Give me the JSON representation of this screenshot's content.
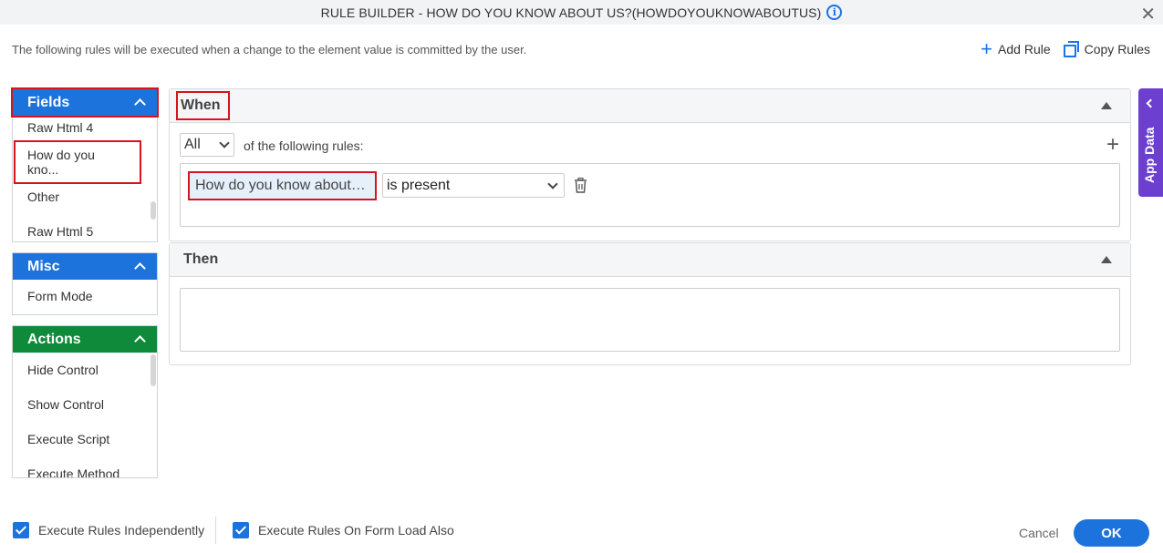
{
  "dialog": {
    "title": "RULE BUILDER - HOW DO YOU KNOW ABOUT US?(HOWDOYOUKNOWABOUTUS)",
    "info_icon": "i",
    "close_icon": "✕",
    "subtitle": "The following rules will be executed when a change to the element value is committed by the user."
  },
  "toolbar": {
    "add_rule_label": "Add Rule",
    "copy_rules_label": "Copy Rules"
  },
  "sidebar": {
    "fields": {
      "title": "Fields",
      "items": [
        "Raw Html 4",
        "How do you kno...",
        "Other",
        "Raw Html 5"
      ]
    },
    "misc": {
      "title": "Misc",
      "items": [
        "Form Mode"
      ]
    },
    "actions": {
      "title": "Actions",
      "items": [
        "Hide Control",
        "Show Control",
        "Execute Script",
        "Execute Method"
      ]
    }
  },
  "when": {
    "title": "When",
    "match_select": "All",
    "rules_label": "of the following rules:",
    "add_icon": "+",
    "condition": {
      "field": "How do you know about…",
      "operator": "is present"
    }
  },
  "then": {
    "title": "Then"
  },
  "app_data": {
    "label": "App Data"
  },
  "footer": {
    "execute_independently": "Execute Rules Independently",
    "execute_on_load": "Execute Rules On Form Load Also",
    "cancel_label": "Cancel",
    "ok_label": "OK"
  },
  "colors": {
    "primary": "#1c73dc",
    "actions_green": "#0e8a3a",
    "app_data_purple": "#6c3fd1",
    "highlight_red": "#d6141b"
  }
}
